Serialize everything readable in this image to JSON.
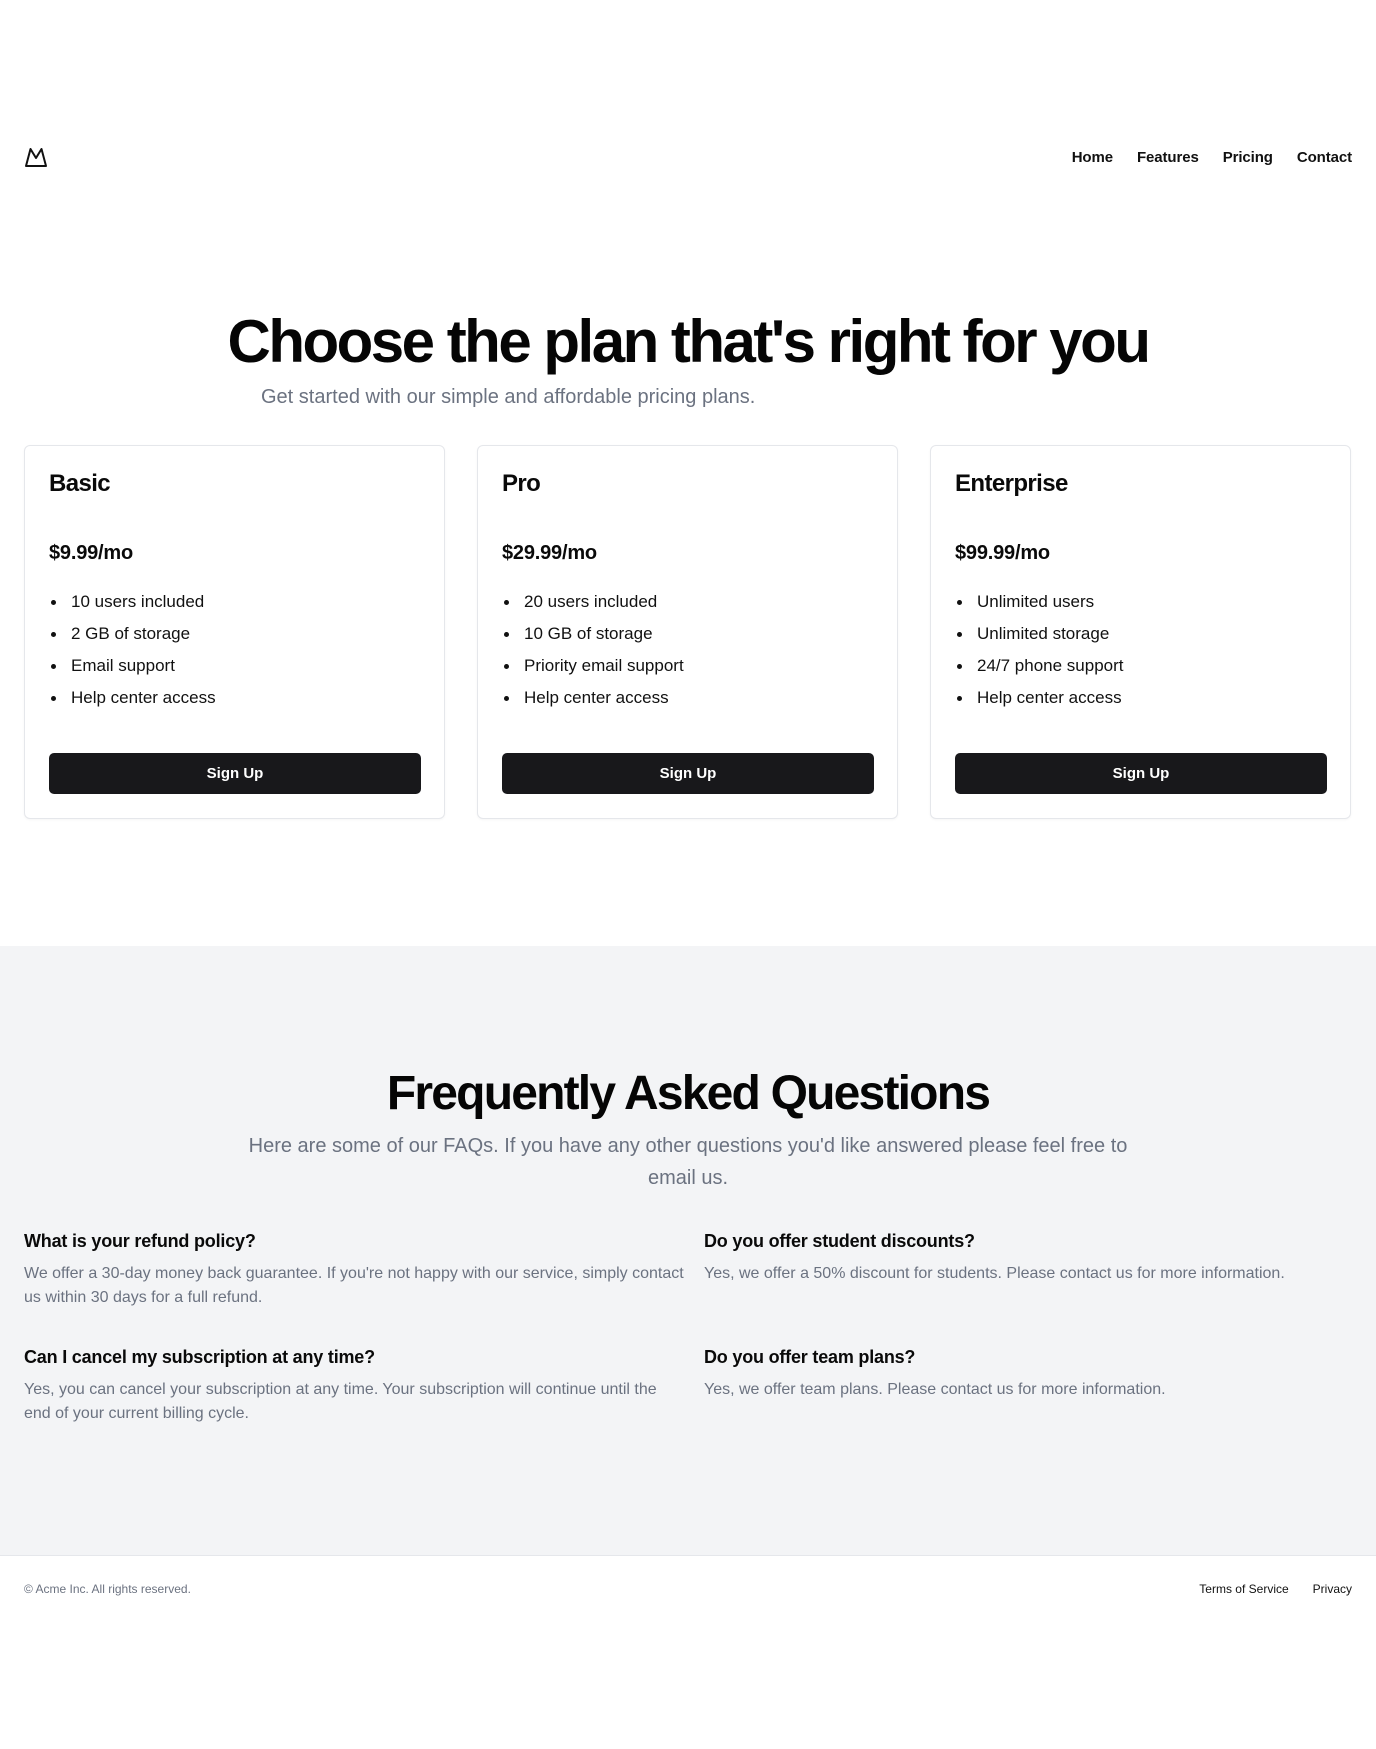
{
  "header": {
    "logo_icon": "mountain-icon",
    "nav": [
      "Home",
      "Features",
      "Pricing",
      "Contact"
    ]
  },
  "hero": {
    "title": "Choose the plan that's right for you",
    "subtitle": "Get started with our simple and affordable pricing plans."
  },
  "plans": [
    {
      "name": "Basic",
      "price": "$9.99/mo",
      "features": [
        "10 users included",
        "2 GB of storage",
        "Email support",
        "Help center access"
      ],
      "cta": "Sign Up"
    },
    {
      "name": "Pro",
      "price": "$29.99/mo",
      "features": [
        "20 users included",
        "10 GB of storage",
        "Priority email support",
        "Help center access"
      ],
      "cta": "Sign Up"
    },
    {
      "name": "Enterprise",
      "price": "$99.99/mo",
      "features": [
        "Unlimited users",
        "Unlimited storage",
        "24/7 phone support",
        "Help center access"
      ],
      "cta": "Sign Up"
    }
  ],
  "faq": {
    "title": "Frequently Asked Questions",
    "subtitle": "Here are some of our FAQs. If you have any other questions you'd like answered please feel free to email us.",
    "items": [
      {
        "question": "What is your refund policy?",
        "answer": "We offer a 30-day money back guarantee. If you're not happy with our service, simply contact us within 30 days for a full refund."
      },
      {
        "question": "Do you offer student discounts?",
        "answer": "Yes, we offer a 50% discount for students. Please contact us for more information."
      },
      {
        "question": "Can I cancel my subscription at any time?",
        "answer": "Yes, you can cancel your subscription at any time. Your subscription will continue until the end of your current billing cycle."
      },
      {
        "question": "Do you offer team plans?",
        "answer": "Yes, we offer team plans. Please contact us for more information."
      }
    ]
  },
  "footer": {
    "copyright": "© Acme Inc. All rights reserved.",
    "links": [
      "Terms of Service",
      "Privacy"
    ]
  },
  "colors": {
    "button_bg": "#18181b",
    "muted_text": "#6b7280",
    "faq_bg": "#f3f4f6",
    "border": "#e5e7eb"
  }
}
